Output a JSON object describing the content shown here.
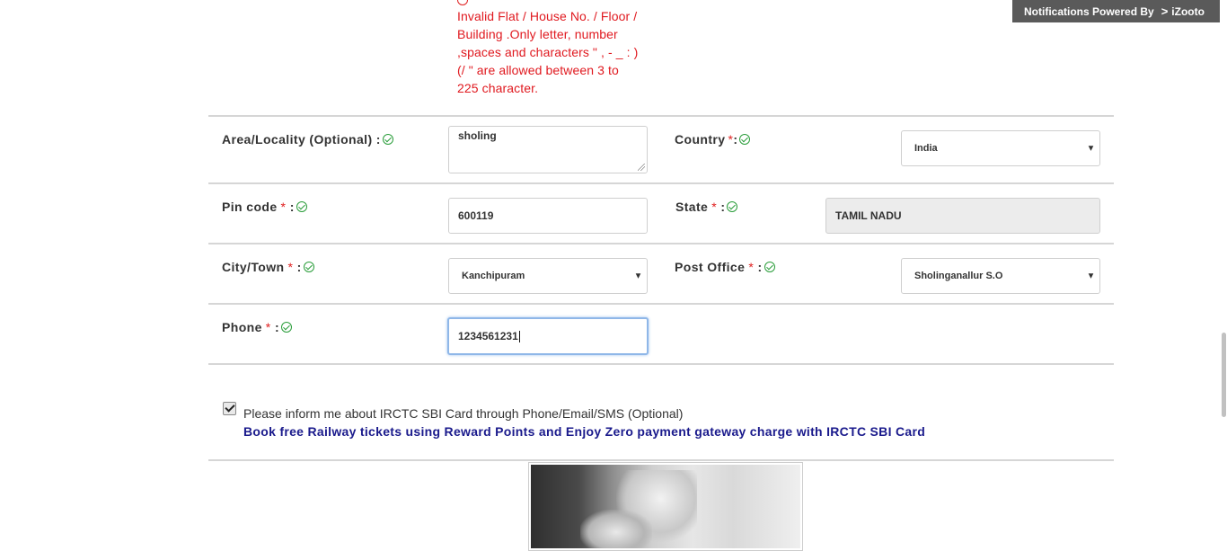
{
  "error_message": "Invalid Flat / House No. / Floor / Building .Only letter, number ,spaces and characters \" , - _ : ) (/ \" are allowed between 3 to 225 character.",
  "notification_bar": {
    "text": "Notifications Powered By",
    "brand": "iZooto"
  },
  "fields": {
    "area": {
      "label": "Area/Locality (Optional) :",
      "value": "sholing"
    },
    "country": {
      "label": "Country",
      "suffix": ":",
      "value": "India"
    },
    "pincode": {
      "label": "Pin code",
      "suffix": ":",
      "value": "600119"
    },
    "state": {
      "label": "State",
      "suffix": ":",
      "value": "TAMIL NADU"
    },
    "city": {
      "label": "City/Town",
      "suffix": ":",
      "value": "Kanchipuram"
    },
    "post_office": {
      "label": "Post Office",
      "suffix": ":",
      "value": "Sholinganallur S.O"
    },
    "phone": {
      "label": "Phone",
      "suffix": ":",
      "value": "1234561231"
    }
  },
  "required_mark": "*",
  "dropdown_caret": "▾",
  "consent": {
    "checked": true,
    "label": "Please inform me about IRCTC SBI Card through Phone/Email/SMS (Optional)",
    "promo": "Book free Railway tickets using Reward Points and Enjoy Zero payment gateway charge with IRCTC SBI Card"
  },
  "colors": {
    "error": "#e0191f",
    "required": "#e02020",
    "valid_check": "#2a9d3a",
    "promo_text": "#1a1a8c",
    "notification_bg": "#5a5a5a"
  }
}
